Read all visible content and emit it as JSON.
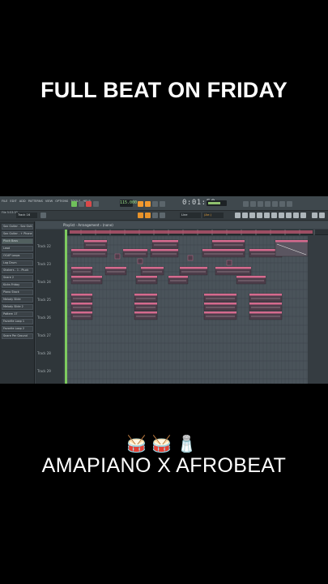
{
  "headline": "FULL BEAT ON FRIDAY",
  "footer": {
    "emoji": "🥁🥁🧂",
    "caption": "AMAPIANO X AFROBEAT"
  },
  "daw": {
    "menu": [
      "FILE",
      "EDIT",
      "ADD",
      "PATTERNS",
      "VIEW",
      "OPTIONS",
      "TOOLS",
      "HELP"
    ],
    "tempo": "115.000",
    "timer": "0:01:59",
    "file_label": "File\n5:53:30",
    "pattern_name": "Track 16",
    "snap": "(Arr.)",
    "snap_mode": "Line",
    "playlist_title": "Playlist - Arrangement › (none)",
    "browser_items": [
      "Sax Guitar - Sax Guitar",
      "Sax Guitar - + Phone",
      "Pluck Bass",
      "Lead",
      "OCAP Loops",
      "Log Drum",
      "Shakers - 1 - Pluck",
      "Snare 2",
      "Kicks Friday",
      "Piano Stack",
      "Melody Slide",
      "Melody Slide 2",
      "Pattern 17",
      "Favorite Loop 1",
      "Favorite Loop 2",
      "Snare Per Ground"
    ],
    "tracks": [
      "Track 22",
      "Track 23",
      "Track 24",
      "Track 25",
      "Track 26",
      "Track 27",
      "Track 28",
      "Track 29"
    ],
    "colors": {
      "clip_pink": "#d56a8e",
      "clip_dark": "#4d3d4a",
      "clip_text": "#f4d7e0",
      "playhead": "#7ecb5f",
      "accent_orange": "#f2992e"
    }
  }
}
